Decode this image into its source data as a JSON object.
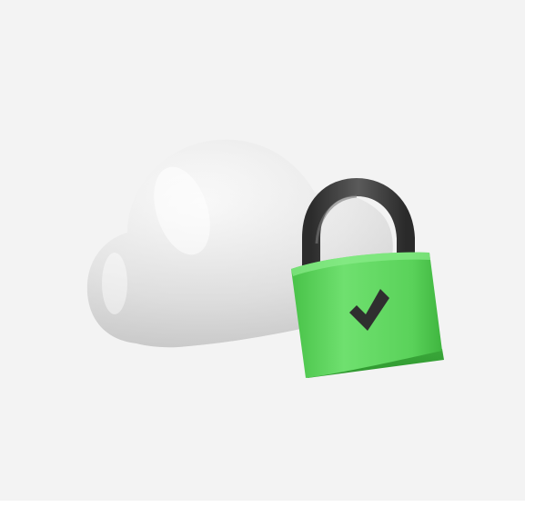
{
  "illustration": {
    "subject": "cloud-with-padlock",
    "icons": [
      "cloud-icon",
      "padlock-icon",
      "checkmark-icon"
    ],
    "colors": {
      "background": "#f3f3f3",
      "page_margin": "#ffffff",
      "cloud": "#e6e6e6",
      "padlock_body": "#5cd35c",
      "padlock_shackle": "#3a3a3a",
      "checkmark": "#2f2f2f"
    }
  }
}
